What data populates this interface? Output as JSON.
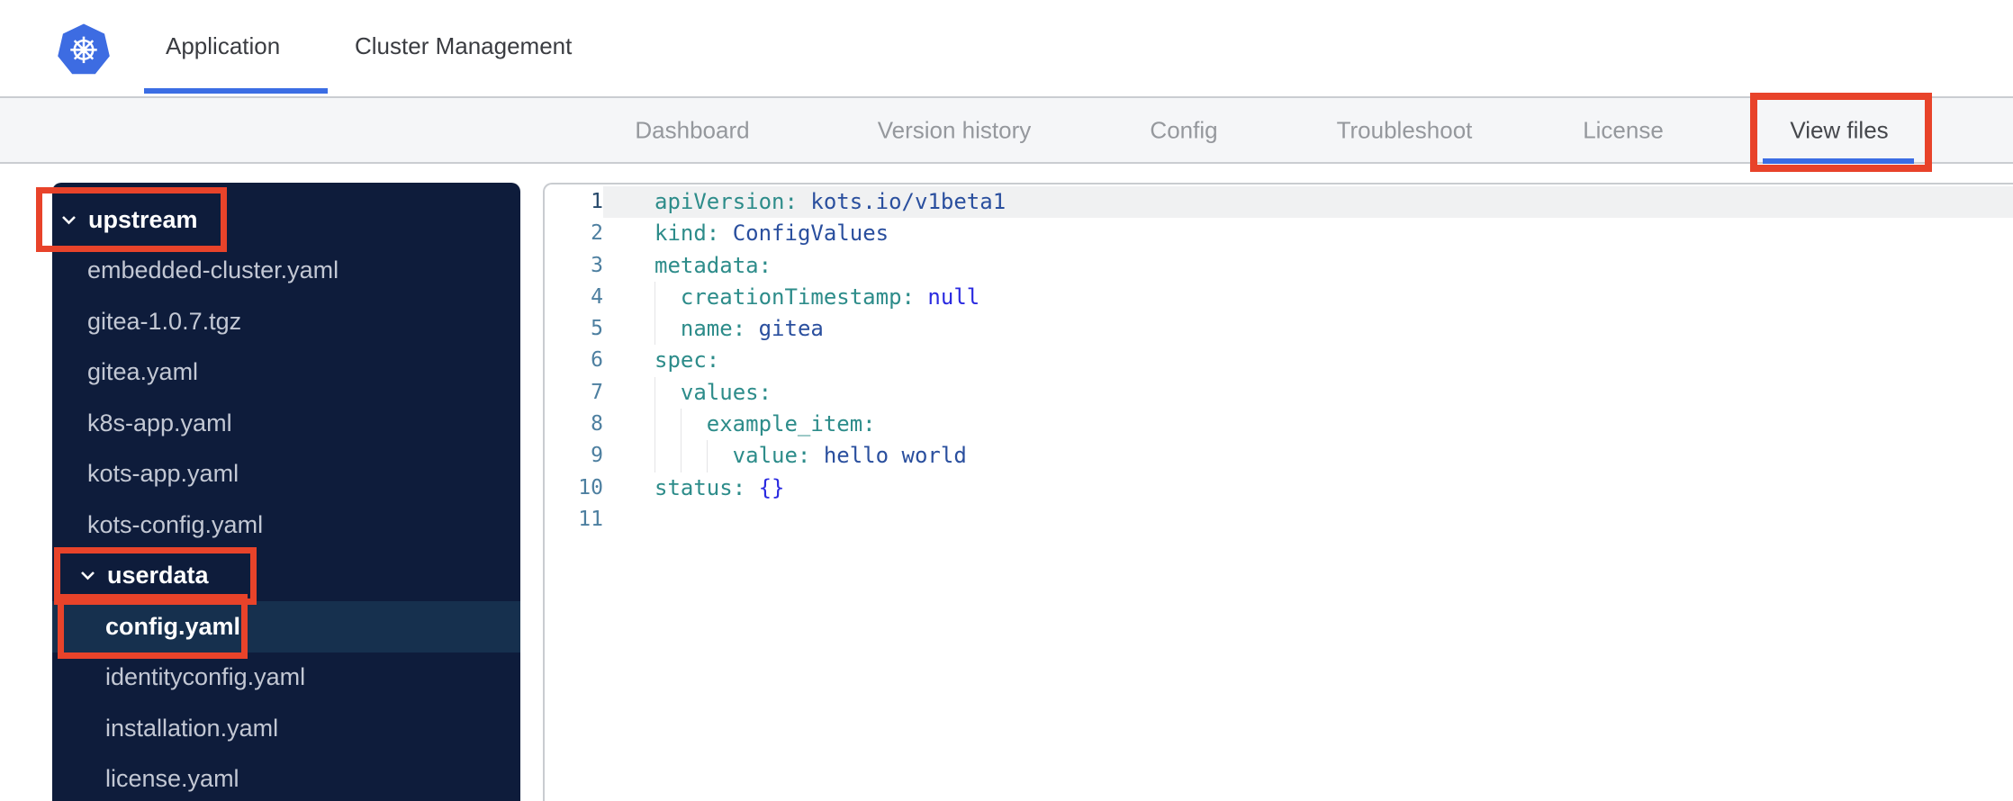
{
  "colors": {
    "accent_blue": "#3b6de4",
    "annotation_red": "#e8432a",
    "brand_blue": "#3d6ce2",
    "sidebar_bg": "#0e1c3b",
    "sidebar_selected_bg": "#16304e",
    "code_key": "#2d8c8a",
    "code_string": "#2a4f9e",
    "code_keyword": "#2a2ae0"
  },
  "header": {
    "brand_icon": "kubernetes-logo",
    "tabs": [
      {
        "label": "Application",
        "active": true
      },
      {
        "label": "Cluster Management",
        "active": false
      }
    ]
  },
  "nav": {
    "items": [
      {
        "label": "Dashboard",
        "active": false
      },
      {
        "label": "Version history",
        "active": false
      },
      {
        "label": "Config",
        "active": false
      },
      {
        "label": "Troubleshoot",
        "active": false
      },
      {
        "label": "License",
        "active": false
      },
      {
        "label": "View files",
        "active": true
      }
    ]
  },
  "file_tree": {
    "items": [
      {
        "label": "upstream",
        "type": "folder",
        "level": 0,
        "expanded": true,
        "selected": false,
        "annotated": true
      },
      {
        "label": "embedded-cluster.yaml",
        "type": "file",
        "level": 1,
        "selected": false
      },
      {
        "label": "gitea-1.0.7.tgz",
        "type": "file",
        "level": 1,
        "selected": false
      },
      {
        "label": "gitea.yaml",
        "type": "file",
        "level": 1,
        "selected": false
      },
      {
        "label": "k8s-app.yaml",
        "type": "file",
        "level": 1,
        "selected": false
      },
      {
        "label": "kots-app.yaml",
        "type": "file",
        "level": 1,
        "selected": false
      },
      {
        "label": "kots-config.yaml",
        "type": "file",
        "level": 1,
        "selected": false
      },
      {
        "label": "userdata",
        "type": "folder",
        "level": 1,
        "expanded": true,
        "selected": false,
        "annotated": true
      },
      {
        "label": "config.yaml",
        "type": "file",
        "level": 2,
        "selected": true,
        "annotated": true
      },
      {
        "label": "identityconfig.yaml",
        "type": "file",
        "level": 2,
        "selected": false
      },
      {
        "label": "installation.yaml",
        "type": "file",
        "level": 2,
        "selected": false
      },
      {
        "label": "license.yaml",
        "type": "file",
        "level": 2,
        "selected": false
      }
    ]
  },
  "editor": {
    "file_name": "config.yaml",
    "lines": [
      {
        "num": 1,
        "active": true,
        "indent": 0,
        "tokens": [
          [
            "key",
            "apiVersion:"
          ],
          [
            "str",
            " kots.io/v1beta1"
          ]
        ]
      },
      {
        "num": 2,
        "active": false,
        "indent": 0,
        "tokens": [
          [
            "key",
            "kind:"
          ],
          [
            "str",
            " ConfigValues"
          ]
        ]
      },
      {
        "num": 3,
        "active": false,
        "indent": 0,
        "tokens": [
          [
            "key",
            "metadata:"
          ]
        ]
      },
      {
        "num": 4,
        "active": false,
        "indent": 1,
        "tokens": [
          [
            "key",
            "creationTimestamp:"
          ],
          [
            "kw",
            " null"
          ]
        ]
      },
      {
        "num": 5,
        "active": false,
        "indent": 1,
        "tokens": [
          [
            "key",
            "name:"
          ],
          [
            "str",
            " gitea"
          ]
        ]
      },
      {
        "num": 6,
        "active": false,
        "indent": 0,
        "tokens": [
          [
            "key",
            "spec:"
          ]
        ]
      },
      {
        "num": 7,
        "active": false,
        "indent": 1,
        "tokens": [
          [
            "key",
            "values:"
          ]
        ]
      },
      {
        "num": 8,
        "active": false,
        "indent": 2,
        "tokens": [
          [
            "key",
            "example_item:"
          ]
        ]
      },
      {
        "num": 9,
        "active": false,
        "indent": 3,
        "tokens": [
          [
            "key",
            "value:"
          ],
          [
            "str",
            " hello world"
          ]
        ]
      },
      {
        "num": 10,
        "active": false,
        "indent": 0,
        "tokens": [
          [
            "key",
            "status:"
          ],
          [
            "kw",
            " {}"
          ]
        ]
      },
      {
        "num": 11,
        "active": false,
        "indent": 0,
        "tokens": []
      }
    ]
  },
  "annotations": {
    "color": "#e8432a",
    "targets": [
      "View files tab",
      "upstream folder",
      "userdata folder",
      "config.yaml file"
    ]
  }
}
